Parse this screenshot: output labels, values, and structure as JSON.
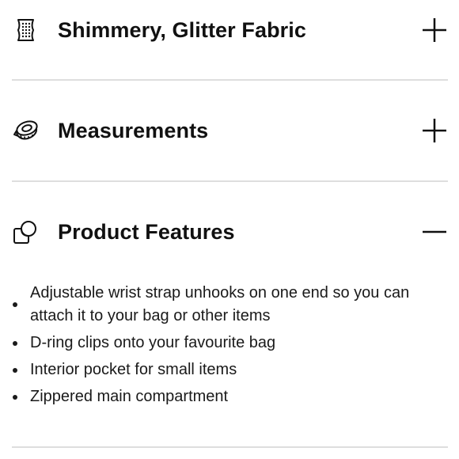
{
  "accordion": {
    "sections": [
      {
        "title": "Shimmery, Glitter Fabric",
        "icon": "fabric-icon",
        "toggle_icon": "plus-icon",
        "expanded": false
      },
      {
        "title": "Measurements",
        "icon": "measuring-tape-icon",
        "toggle_icon": "plus-icon",
        "expanded": false
      },
      {
        "title": "Product Features",
        "icon": "overlapping-shapes-icon",
        "toggle_icon": "minus-icon",
        "expanded": true,
        "features": [
          "Adjustable wrist strap unhooks on one end so you can attach it to your bag or other items",
          "D-ring clips onto your favourite bag",
          "Interior pocket for small items",
          "Zippered main compartment"
        ]
      }
    ]
  },
  "colors": {
    "text": "#111111",
    "divider": "#dedede",
    "background": "#ffffff"
  }
}
